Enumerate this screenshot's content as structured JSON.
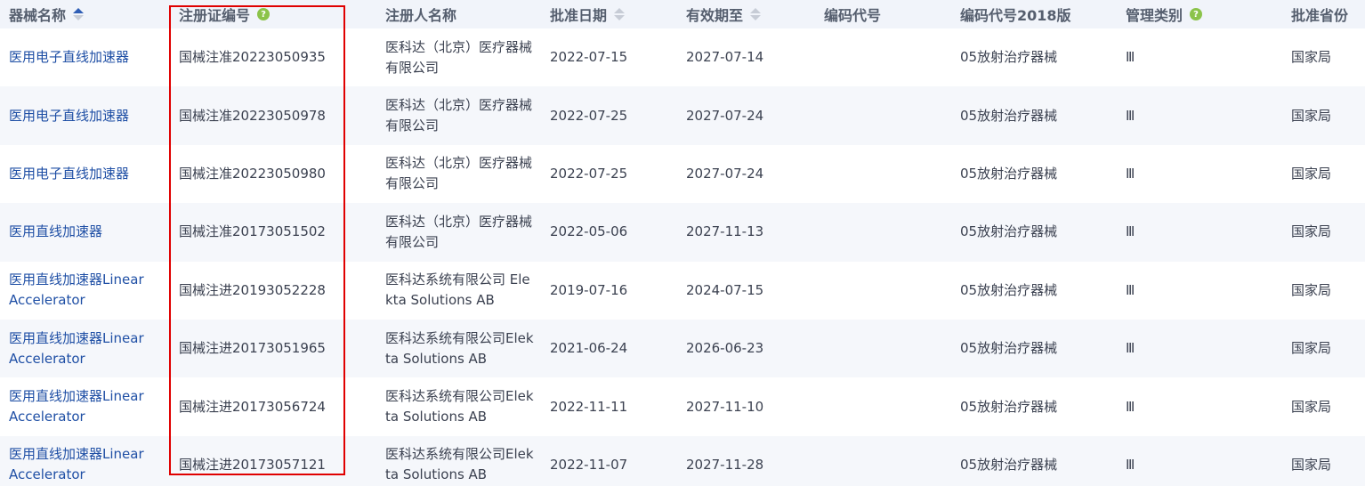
{
  "headers": {
    "name": "器械名称",
    "reg_no": "注册证编号",
    "holder": "注册人名称",
    "approval_date": "批准日期",
    "valid_until": "有效期至",
    "code": "编码代号",
    "code_2018": "编码代号2018版",
    "mgmt_class": "管理类别",
    "province": "批准省份"
  },
  "rows": [
    {
      "name": "医用电子直线加速器",
      "reg_no": "国械注准20223050935",
      "holder": "医科达（北京）医疗器械有限公司",
      "approval_date": "2022-07-15",
      "valid_until": "2027-07-14",
      "code": "",
      "code_2018": "05放射治疗器械",
      "mgmt_class": "Ⅲ",
      "province": "国家局"
    },
    {
      "name": "医用电子直线加速器",
      "reg_no": "国械注准20223050978",
      "holder": "医科达（北京）医疗器械有限公司",
      "approval_date": "2022-07-25",
      "valid_until": "2027-07-24",
      "code": "",
      "code_2018": "05放射治疗器械",
      "mgmt_class": "Ⅲ",
      "province": "国家局"
    },
    {
      "name": "医用电子直线加速器",
      "reg_no": "国械注准20223050980",
      "holder": "医科达（北京）医疗器械有限公司",
      "approval_date": "2022-07-25",
      "valid_until": "2027-07-24",
      "code": "",
      "code_2018": "05放射治疗器械",
      "mgmt_class": "Ⅲ",
      "province": "国家局"
    },
    {
      "name": "医用直线加速器",
      "reg_no": "国械注准20173051502",
      "holder": "医科达（北京）医疗器械有限公司",
      "approval_date": "2022-05-06",
      "valid_until": "2027-11-13",
      "code": "",
      "code_2018": "05放射治疗器械",
      "mgmt_class": "Ⅲ",
      "province": "国家局"
    },
    {
      "name": "医用直线加速器Linear Accelerator",
      "reg_no": "国械注进20193052228",
      "holder": "医科达系统有限公司 Elekta Solutions AB",
      "approval_date": "2019-07-16",
      "valid_until": "2024-07-15",
      "code": "",
      "code_2018": "05放射治疗器械",
      "mgmt_class": "Ⅲ",
      "province": "国家局"
    },
    {
      "name": "医用直线加速器Linear Accelerator",
      "reg_no": "国械注进20173051965",
      "holder": "医科达系统有限公司Elekta Solutions AB",
      "approval_date": "2021-06-24",
      "valid_until": "2026-06-23",
      "code": "",
      "code_2018": "05放射治疗器械",
      "mgmt_class": "Ⅲ",
      "province": "国家局"
    },
    {
      "name": "医用直线加速器Linear Accelerator",
      "reg_no": "国械注进20173056724",
      "holder": "医科达系统有限公司Elekta Solutions AB",
      "approval_date": "2022-11-11",
      "valid_until": "2027-11-10",
      "code": "",
      "code_2018": "05放射治疗器械",
      "mgmt_class": "Ⅲ",
      "province": "国家局"
    },
    {
      "name": "医用直线加速器Linear Accelerator",
      "reg_no": "国械注进20173057121",
      "holder": "医科达系统有限公司Elekta Solutions AB",
      "approval_date": "2022-11-07",
      "valid_until": "2027-11-28",
      "code": "",
      "code_2018": "05放射治疗器械",
      "mgmt_class": "Ⅲ",
      "province": "国家局"
    }
  ],
  "colors": {
    "highlight": "#e00000",
    "link": "#1f4fa5",
    "help_badge": "#8bc34a"
  },
  "icons": {
    "sort": "sort-icon",
    "help": "help-icon"
  }
}
